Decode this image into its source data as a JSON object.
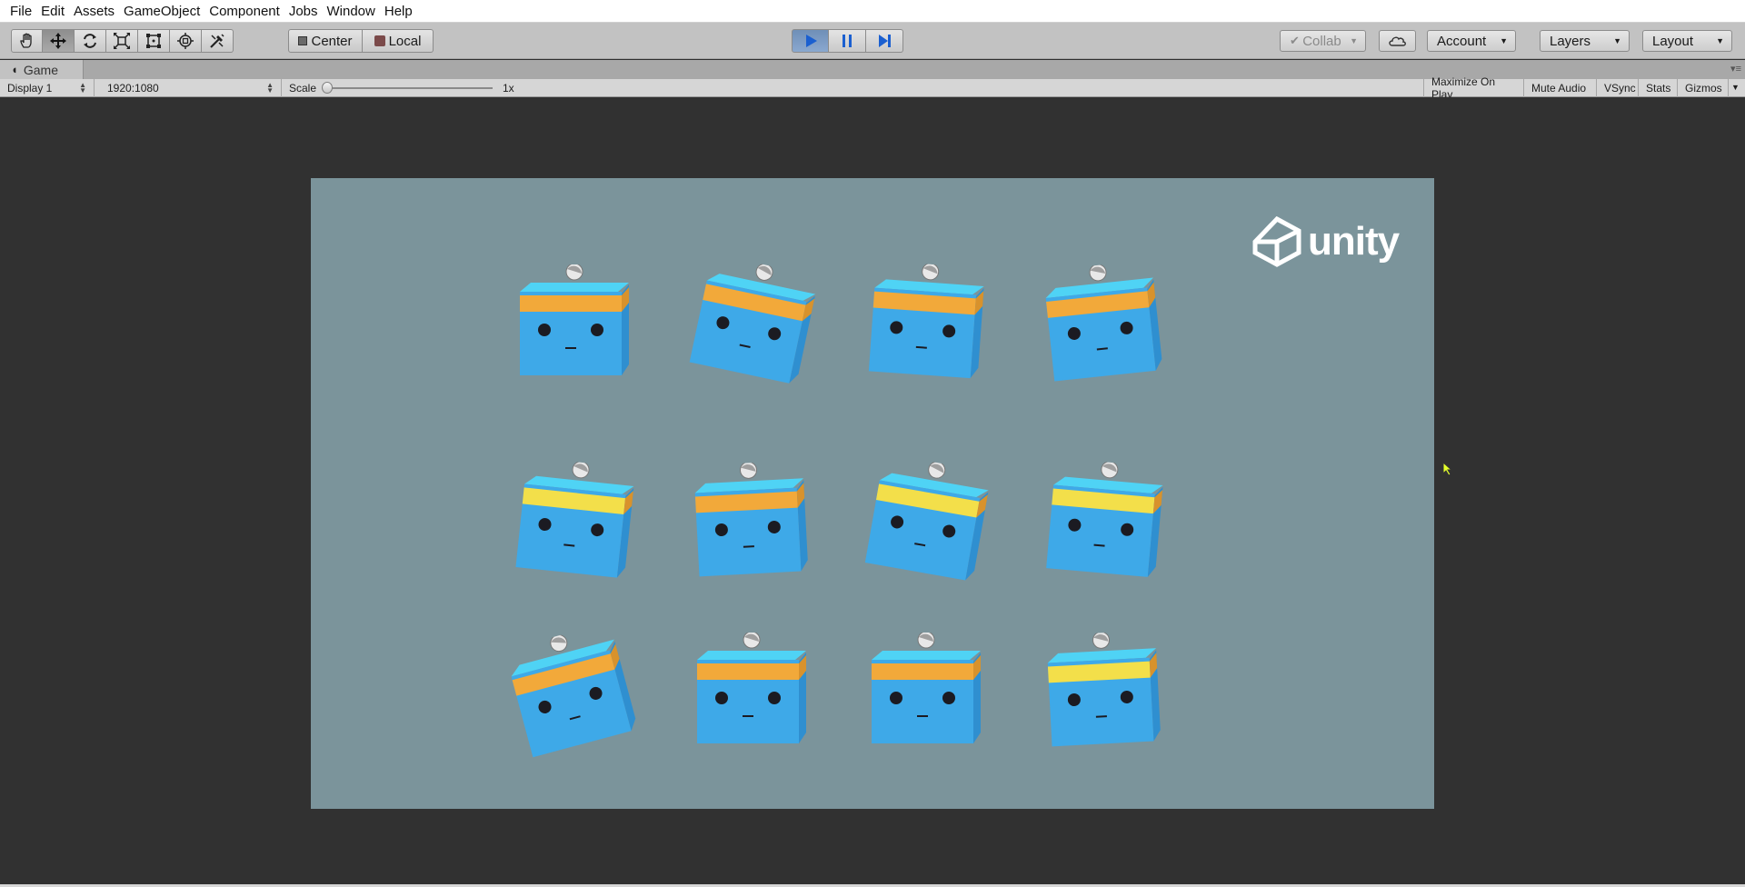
{
  "menu": {
    "items": [
      "File",
      "Edit",
      "Assets",
      "GameObject",
      "Component",
      "Jobs",
      "Window",
      "Help"
    ]
  },
  "toolbar": {
    "transform_tools": [
      "hand-icon",
      "move-icon",
      "rotate-icon",
      "scale-icon",
      "rect-icon",
      "transform-icon",
      "custom-tool-icon"
    ],
    "pivot_label": "Center",
    "space_label": "Local",
    "play_controls": [
      "play-icon",
      "pause-icon",
      "step-icon"
    ],
    "collab_label": "Collab",
    "account_label": "Account",
    "layers_label": "Layers",
    "layout_label": "Layout"
  },
  "game_tab": {
    "title": "Game"
  },
  "game_toolbar": {
    "display": "Display 1",
    "resolution": "1920:1080",
    "scale_label": "Scale",
    "scale_value": "1x",
    "scale_fraction": 0.0,
    "maximize_on_play": "Maximize On Play",
    "mute_audio": "Mute Audio",
    "vsync": "VSync",
    "stats": "Stats",
    "gizmos": "Gizmos"
  },
  "scene": {
    "logo_text": "unity",
    "cube_count": 12
  },
  "colors": {
    "viewport_bg": "#7b949b",
    "cube_blue": "#3ea9e8",
    "cube_top": "#4fd3f5",
    "band_orange": "#f2a93a",
    "band_yellow": "#f3df4a",
    "play_active": "#7a9ac3"
  }
}
